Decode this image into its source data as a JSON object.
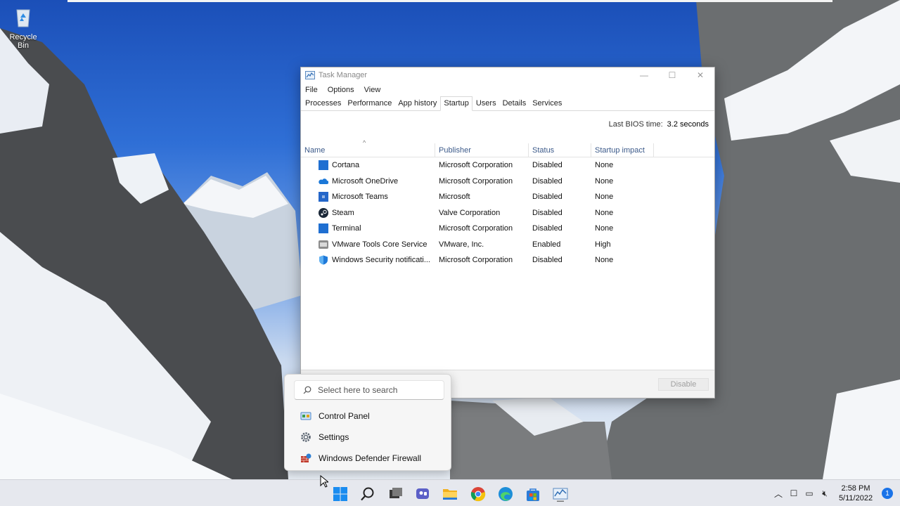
{
  "desktop": {
    "recycle_bin_label": "Recycle Bin"
  },
  "window": {
    "title": "Task Manager",
    "controls": {
      "minimize": "—",
      "maximize": "☐",
      "close": "✕"
    },
    "menu": [
      "File",
      "Options",
      "View"
    ],
    "tabs": [
      "Processes",
      "Performance",
      "App history",
      "Startup",
      "Users",
      "Details",
      "Services"
    ],
    "active_tab": "Startup",
    "bios_label": "Last BIOS time:",
    "bios_value": "3.2 seconds",
    "columns": {
      "name": "Name",
      "publisher": "Publisher",
      "status": "Status",
      "impact": "Startup impact"
    },
    "rows": [
      {
        "name": "Cortana",
        "publisher": "Microsoft Corporation",
        "status": "Disabled",
        "impact": "None",
        "icon": "cortana-icon"
      },
      {
        "name": "Microsoft OneDrive",
        "publisher": "Microsoft Corporation",
        "status": "Disabled",
        "impact": "None",
        "icon": "onedrive-icon"
      },
      {
        "name": "Microsoft Teams",
        "publisher": "Microsoft",
        "status": "Disabled",
        "impact": "None",
        "icon": "teams-icon"
      },
      {
        "name": "Steam",
        "publisher": "Valve Corporation",
        "status": "Disabled",
        "impact": "None",
        "icon": "steam-icon"
      },
      {
        "name": "Terminal",
        "publisher": "Microsoft Corporation",
        "status": "Disabled",
        "impact": "None",
        "icon": "terminal-icon"
      },
      {
        "name": "VMware Tools Core Service",
        "publisher": "VMware, Inc.",
        "status": "Enabled",
        "impact": "High",
        "icon": "vmware-icon"
      },
      {
        "name": "Windows Security notificati...",
        "publisher": "Microsoft Corporation",
        "status": "Disabled",
        "impact": "None",
        "icon": "shield-icon"
      }
    ],
    "disable_button": "Disable"
  },
  "flyout": {
    "search_placeholder": "Select here to search",
    "items": [
      "Control Panel",
      "Settings",
      "Windows Defender Firewall"
    ]
  },
  "tray": {
    "time": "2:58 PM",
    "date": "5/11/2022",
    "notifications": "1"
  },
  "colors": {
    "accent": "#0067c0",
    "taskbar": "#e6e8ee"
  }
}
